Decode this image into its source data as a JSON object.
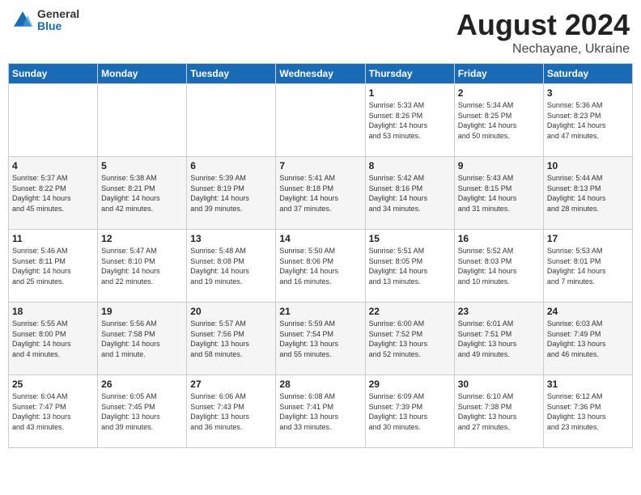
{
  "header": {
    "logo_general": "General",
    "logo_blue": "Blue",
    "month": "August 2024",
    "location": "Nechayane, Ukraine"
  },
  "days_of_week": [
    "Sunday",
    "Monday",
    "Tuesday",
    "Wednesday",
    "Thursday",
    "Friday",
    "Saturday"
  ],
  "weeks": [
    [
      {
        "num": "",
        "info": ""
      },
      {
        "num": "",
        "info": ""
      },
      {
        "num": "",
        "info": ""
      },
      {
        "num": "",
        "info": ""
      },
      {
        "num": "1",
        "info": "Sunrise: 5:33 AM\nSunset: 8:26 PM\nDaylight: 14 hours\nand 53 minutes."
      },
      {
        "num": "2",
        "info": "Sunrise: 5:34 AM\nSunset: 8:25 PM\nDaylight: 14 hours\nand 50 minutes."
      },
      {
        "num": "3",
        "info": "Sunrise: 5:36 AM\nSunset: 8:23 PM\nDaylight: 14 hours\nand 47 minutes."
      }
    ],
    [
      {
        "num": "4",
        "info": "Sunrise: 5:37 AM\nSunset: 8:22 PM\nDaylight: 14 hours\nand 45 minutes."
      },
      {
        "num": "5",
        "info": "Sunrise: 5:38 AM\nSunset: 8:21 PM\nDaylight: 14 hours\nand 42 minutes."
      },
      {
        "num": "6",
        "info": "Sunrise: 5:39 AM\nSunset: 8:19 PM\nDaylight: 14 hours\nand 39 minutes."
      },
      {
        "num": "7",
        "info": "Sunrise: 5:41 AM\nSunset: 8:18 PM\nDaylight: 14 hours\nand 37 minutes."
      },
      {
        "num": "8",
        "info": "Sunrise: 5:42 AM\nSunset: 8:16 PM\nDaylight: 14 hours\nand 34 minutes."
      },
      {
        "num": "9",
        "info": "Sunrise: 5:43 AM\nSunset: 8:15 PM\nDaylight: 14 hours\nand 31 minutes."
      },
      {
        "num": "10",
        "info": "Sunrise: 5:44 AM\nSunset: 8:13 PM\nDaylight: 14 hours\nand 28 minutes."
      }
    ],
    [
      {
        "num": "11",
        "info": "Sunrise: 5:46 AM\nSunset: 8:11 PM\nDaylight: 14 hours\nand 25 minutes."
      },
      {
        "num": "12",
        "info": "Sunrise: 5:47 AM\nSunset: 8:10 PM\nDaylight: 14 hours\nand 22 minutes."
      },
      {
        "num": "13",
        "info": "Sunrise: 5:48 AM\nSunset: 8:08 PM\nDaylight: 14 hours\nand 19 minutes."
      },
      {
        "num": "14",
        "info": "Sunrise: 5:50 AM\nSunset: 8:06 PM\nDaylight: 14 hours\nand 16 minutes."
      },
      {
        "num": "15",
        "info": "Sunrise: 5:51 AM\nSunset: 8:05 PM\nDaylight: 14 hours\nand 13 minutes."
      },
      {
        "num": "16",
        "info": "Sunrise: 5:52 AM\nSunset: 8:03 PM\nDaylight: 14 hours\nand 10 minutes."
      },
      {
        "num": "17",
        "info": "Sunrise: 5:53 AM\nSunset: 8:01 PM\nDaylight: 14 hours\nand 7 minutes."
      }
    ],
    [
      {
        "num": "18",
        "info": "Sunrise: 5:55 AM\nSunset: 8:00 PM\nDaylight: 14 hours\nand 4 minutes."
      },
      {
        "num": "19",
        "info": "Sunrise: 5:56 AM\nSunset: 7:58 PM\nDaylight: 14 hours\nand 1 minute."
      },
      {
        "num": "20",
        "info": "Sunrise: 5:57 AM\nSunset: 7:56 PM\nDaylight: 13 hours\nand 58 minutes."
      },
      {
        "num": "21",
        "info": "Sunrise: 5:59 AM\nSunset: 7:54 PM\nDaylight: 13 hours\nand 55 minutes."
      },
      {
        "num": "22",
        "info": "Sunrise: 6:00 AM\nSunset: 7:52 PM\nDaylight: 13 hours\nand 52 minutes."
      },
      {
        "num": "23",
        "info": "Sunrise: 6:01 AM\nSunset: 7:51 PM\nDaylight: 13 hours\nand 49 minutes."
      },
      {
        "num": "24",
        "info": "Sunrise: 6:03 AM\nSunset: 7:49 PM\nDaylight: 13 hours\nand 46 minutes."
      }
    ],
    [
      {
        "num": "25",
        "info": "Sunrise: 6:04 AM\nSunset: 7:47 PM\nDaylight: 13 hours\nand 43 minutes."
      },
      {
        "num": "26",
        "info": "Sunrise: 6:05 AM\nSunset: 7:45 PM\nDaylight: 13 hours\nand 39 minutes."
      },
      {
        "num": "27",
        "info": "Sunrise: 6:06 AM\nSunset: 7:43 PM\nDaylight: 13 hours\nand 36 minutes."
      },
      {
        "num": "28",
        "info": "Sunrise: 6:08 AM\nSunset: 7:41 PM\nDaylight: 13 hours\nand 33 minutes."
      },
      {
        "num": "29",
        "info": "Sunrise: 6:09 AM\nSunset: 7:39 PM\nDaylight: 13 hours\nand 30 minutes."
      },
      {
        "num": "30",
        "info": "Sunrise: 6:10 AM\nSunset: 7:38 PM\nDaylight: 13 hours\nand 27 minutes."
      },
      {
        "num": "31",
        "info": "Sunrise: 6:12 AM\nSunset: 7:36 PM\nDaylight: 13 hours\nand 23 minutes."
      }
    ]
  ]
}
